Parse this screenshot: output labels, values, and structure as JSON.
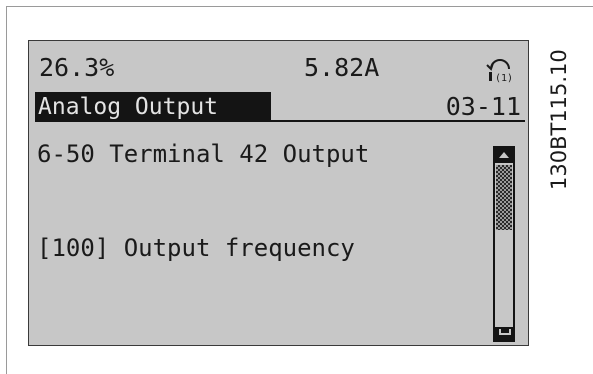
{
  "status": {
    "percent": "26.3%",
    "current": "5.82A",
    "icon": "remote-control-icon"
  },
  "title": {
    "menu": "Analog Output",
    "code": "03-11"
  },
  "parameter": {
    "line": "6-50 Terminal 42 Output",
    "value": "[100] Output frequency"
  },
  "scrollbar": {
    "position_fraction": 0.0
  },
  "figure_code": "130BT115.10",
  "colors": {
    "lcd_background": "#c7c7c7",
    "lcd_ink": "#141414"
  }
}
